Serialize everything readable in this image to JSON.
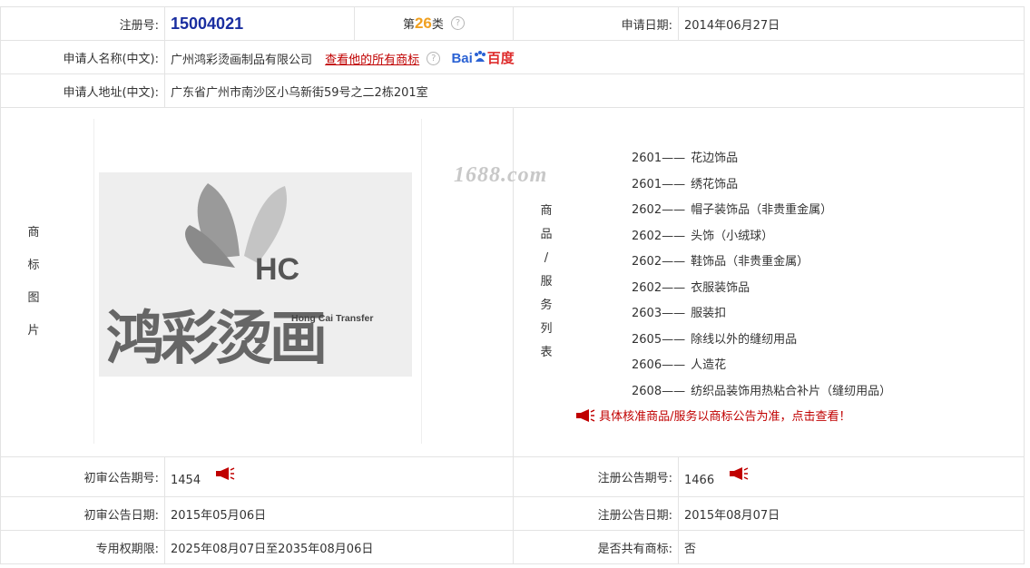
{
  "row1": {
    "reg_label": "注册号:",
    "reg_value": "15004021",
    "class_prefix": "第",
    "class_num": "26",
    "class_suffix": "类",
    "date_label": "申请日期:",
    "date_value": "2014年06月27日"
  },
  "applicant": {
    "name_label": "申请人名称(中文):",
    "name_value": "广州鸿彩烫画制品有限公司",
    "all_marks_link": "查看他的所有商标",
    "addr_label": "申请人地址(中文):",
    "addr_value": "广东省广州市南沙区小乌新街59号之二2栋201室"
  },
  "baidu": {
    "part1": "Bai",
    "part2": "百度"
  },
  "image_label_chars": [
    "商",
    "标",
    "图",
    "片"
  ],
  "logo": {
    "mark": "HC",
    "cn": "鸿彩烫画",
    "en": "Hong Cai Transfer"
  },
  "watermark": "1688.com",
  "goods_label_chars": [
    "商",
    "品",
    "/",
    "服",
    "务",
    "列",
    "表"
  ],
  "goods": [
    {
      "code": "2601",
      "sep": "——",
      "name": "花边饰品"
    },
    {
      "code": "2601",
      "sep": "——",
      "name": "绣花饰品"
    },
    {
      "code": "2602",
      "sep": "——",
      "name": "帽子装饰品（非贵重金属）"
    },
    {
      "code": "2602",
      "sep": "——",
      "name": "头饰（小绒球）"
    },
    {
      "code": "2602",
      "sep": "——",
      "name": "鞋饰品（非贵重金属）"
    },
    {
      "code": "2602",
      "sep": "——",
      "name": "衣服装饰品"
    },
    {
      "code": "2603",
      "sep": "——",
      "name": "服装扣"
    },
    {
      "code": "2605",
      "sep": "——",
      "name": "除线以外的缝纫用品"
    },
    {
      "code": "2606",
      "sep": "——",
      "name": "人造花"
    },
    {
      "code": "2608",
      "sep": "——",
      "name": "纺织品装饰用热粘合补片（缝纫用品）"
    }
  ],
  "notice": "具体核准商品/服务以商标公告为准，点击查看！",
  "bottom": {
    "prelim_no_label": "初审公告期号:",
    "prelim_no_value": "1454",
    "reg_no_label": "注册公告期号:",
    "reg_no_value": "1466",
    "prelim_date_label": "初审公告日期:",
    "prelim_date_value": "2015年05月06日",
    "reg_date_label": "注册公告日期:",
    "reg_date_value": "2015年08月07日",
    "term_label": "专用权期限:",
    "term_value": "2025年08月07日至2035年08月06日",
    "shared_label": "是否共有商标:",
    "shared_value": "否"
  },
  "colors": {
    "reg_blue": "#1a2ea0",
    "class_orange": "#f0a020",
    "link_red": "#c00000",
    "border": "#e3e3e3"
  }
}
